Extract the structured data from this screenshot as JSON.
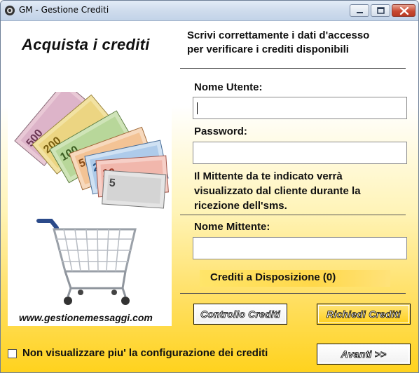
{
  "window": {
    "title": "GM - Gestione Crediti"
  },
  "promo": {
    "title": "Acquista i crediti",
    "website": "www.gestionemessaggi.com",
    "banknote_values": [
      "500",
      "200",
      "100",
      "50",
      "20",
      "10",
      "5"
    ]
  },
  "form": {
    "heading_line1": "Scrivi correttamente i dati d'accesso",
    "heading_line2": "per verificare i crediti disponibili",
    "username_label": "Nome Utente:",
    "username_value": "",
    "password_label": "Password:",
    "password_value": "",
    "notice_line1": "Il Mittente da te indicato verrà",
    "notice_line2": "visualizzato dal cliente durante la",
    "notice_line3": "ricezione dell'sms.",
    "sender_label": "Nome Mittente:",
    "sender_value": "",
    "credits_text": "Crediti a Disposizione (0)"
  },
  "buttons": {
    "check_credits": "Controllo Crediti",
    "request_credits": "Richiedi Crediti",
    "next": "Avanti >>"
  },
  "footer": {
    "checkbox_label": "Non visualizzare piu' la configurazione dei crediti",
    "checkbox_checked": false
  },
  "colors": {
    "gradient_yellow": "#ffd21c",
    "titlebar": "#cfdced",
    "close_button": "#c94a33"
  }
}
